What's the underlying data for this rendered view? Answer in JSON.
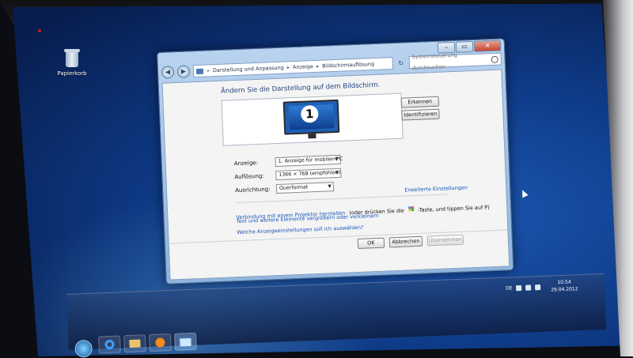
{
  "desktop": {
    "recycle_bin_label": "Papierkorb"
  },
  "window": {
    "controls": {
      "minimize": "–",
      "maximize": "▭",
      "close": "✕"
    },
    "nav": {
      "back": "◀",
      "forward": "▶"
    },
    "breadcrumb": [
      "Darstellung und Anpassung",
      "Anzeige",
      "Bildschirmauflösung"
    ],
    "breadcrumb_prefix": "«",
    "breadcrumb_sep": "▸",
    "refresh": "↻",
    "search_placeholder": "Systemsteuerung durchsuchen"
  },
  "content": {
    "heading": "Ändern Sie die Darstellung auf dem Bildschirm.",
    "monitor_number": "1",
    "detect_button": "Erkennen",
    "identify_button": "Identifizieren",
    "display_label": "Anzeige:",
    "display_value": "1. Anzeige für mobilen PC",
    "resolution_label": "Auflösung:",
    "resolution_value": "1366 × 768 (empfohlen)",
    "orientation_label": "Ausrichtung:",
    "orientation_value": "Querformat",
    "advanced_link": "Erweiterte Einstellungen",
    "projector_link": "Verbindung mit einem Projektor herstellen",
    "projector_hint_pre": "(oder drücken Sie die",
    "projector_hint_post": "-Taste, und tippen Sie auf P)",
    "text_size_link": "Text und weitere Elemente vergrößern oder verkleinern",
    "which_settings_link": "Welche Anzeigeeinstellungen soll ich auswählen?",
    "ok_button": "OK",
    "cancel_button": "Abbrechen",
    "apply_button": "Übernehmen"
  },
  "taskbar": {
    "language": "DE",
    "time": "10:54",
    "date": "29.04.2012"
  },
  "colors": {
    "link": "#1a56b8",
    "heading": "#1e3f7a",
    "desktop": "#1d58b4"
  }
}
